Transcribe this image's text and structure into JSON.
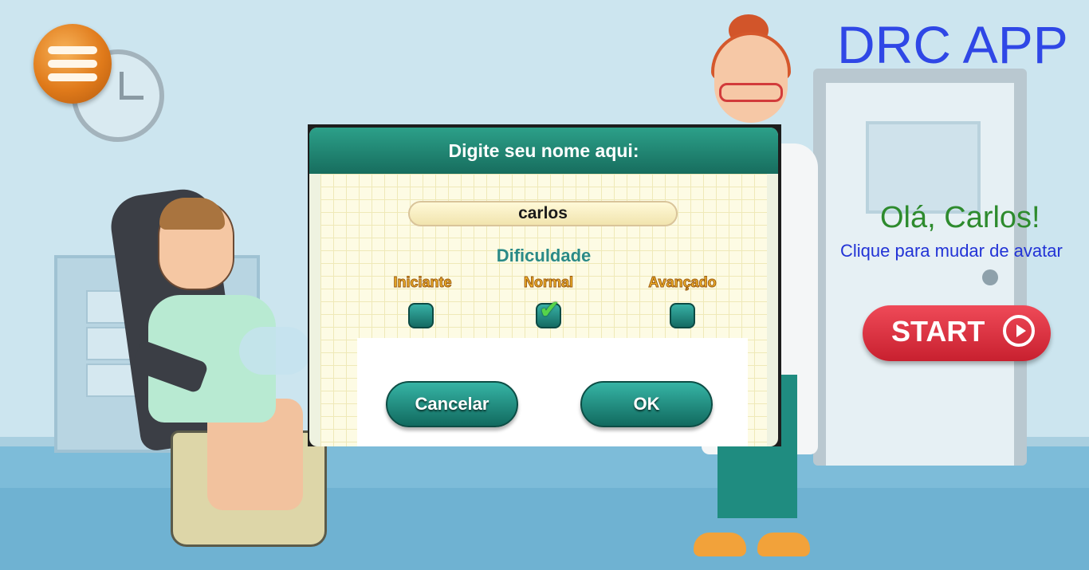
{
  "app": {
    "title": "DRC APP",
    "greeting": "Olá, Carlos!",
    "avatar_hint": "Clique para mudar de avatar",
    "start_label": "START",
    "menu_icon": "hamburger-menu-icon",
    "start_icon": "play-circle-icon"
  },
  "dialog": {
    "title": "Digite seu nome aqui:",
    "name_value": "carlos",
    "difficulty_label": "Dificuldade",
    "options": [
      {
        "label": "Iniciante",
        "checked": false
      },
      {
        "label": "Normal",
        "checked": true
      },
      {
        "label": "Avançado",
        "checked": false
      }
    ],
    "cancel_label": "Cancelar",
    "ok_label": "OK"
  },
  "colors": {
    "title": "#2f47e6",
    "greeting": "#2e8b2e",
    "hint": "#2233d6",
    "start": "#d92b3a",
    "dialog_header": "#1f8a75",
    "menu": "#e07a1a"
  }
}
